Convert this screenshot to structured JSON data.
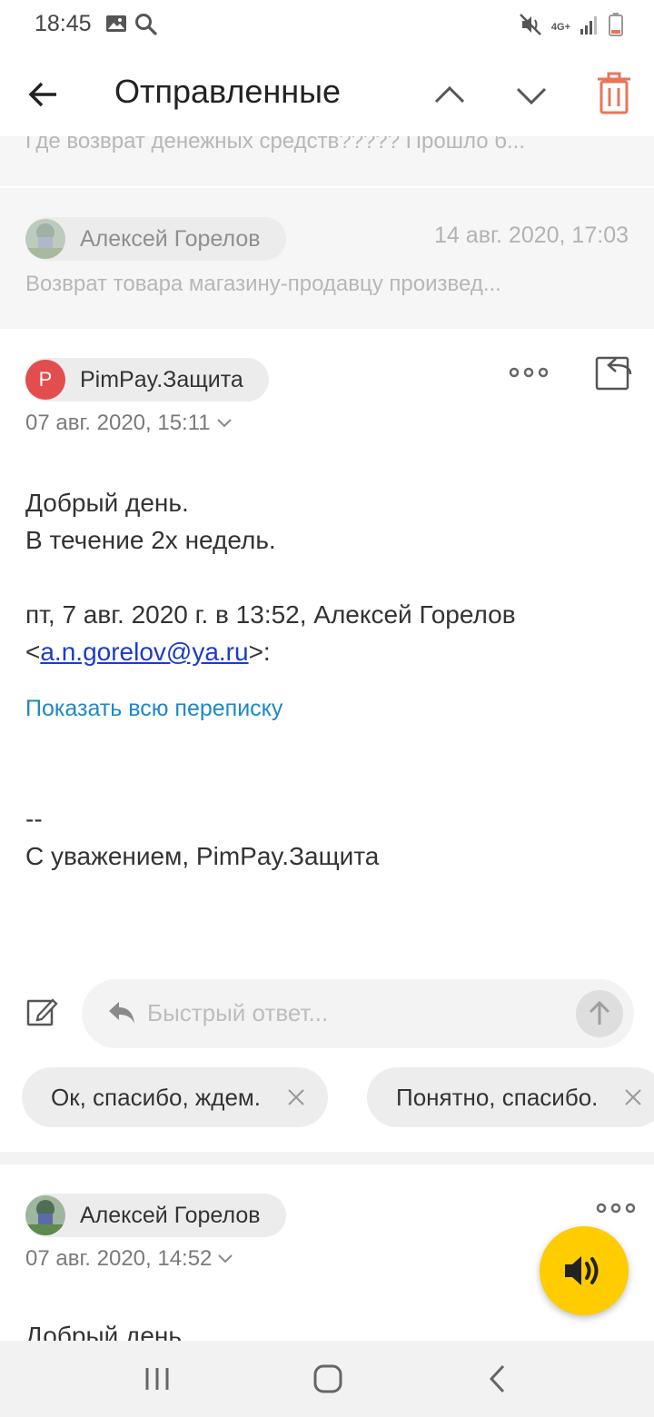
{
  "status_bar": {
    "time": "18:45",
    "network_label": "4G+"
  },
  "app_bar": {
    "title": "Отправленные"
  },
  "collapsed_messages": [
    {
      "snippet": "Где возврат денежных средств????? Прошло б..."
    },
    {
      "sender": "Алексей Горелов",
      "date": "14 авг. 2020, 17:03",
      "snippet": "Возврат товара магазину-продавцу произвед..."
    }
  ],
  "open_message": {
    "sender": "PimPay.Защита",
    "avatar_letter": "P",
    "avatar_color": "#e34d4d",
    "date": "07 авг. 2020, 15:11",
    "greeting": "Добрый день.",
    "line2": "В течение 2х недель.",
    "quote_header": "пт, 7 авг. 2020 г. в 13:52, Алексей Горелов",
    "quote_email_open": "<",
    "quote_email": "a.n.gorelov@ya.ru",
    "quote_email_close": ">:",
    "show_all_label": "Показать всю переписку",
    "signature_dash": "--",
    "signature": "С уважением, PimPay.Защита"
  },
  "quick_reply": {
    "placeholder": "Быстрый ответ..."
  },
  "suggested_replies": [
    {
      "label": "Ок, спасибо, ждем."
    },
    {
      "label": "Понятно, спасибо."
    }
  ],
  "next_message": {
    "sender": "Алексей Горелов",
    "date": "07 авг. 2020, 14:52",
    "preview": "Добрый день"
  },
  "colors": {
    "accent_trash": "#e8755a",
    "fab": "#ffcc00",
    "link": "#1e88c8"
  }
}
